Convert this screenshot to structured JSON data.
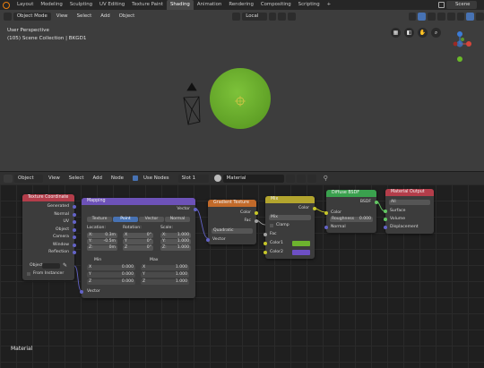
{
  "workspace_tabs": [
    "Layout",
    "Modeling",
    "Sculpting",
    "UV Editing",
    "Texture Paint",
    "Shading",
    "Animation",
    "Rendering",
    "Compositing",
    "Scripting",
    "+"
  ],
  "active_tab_index": 5,
  "scene_name": "Scene",
  "viewport": {
    "mode": "Object Mode",
    "menus": [
      "View",
      "Select",
      "Add",
      "Object"
    ],
    "transform_orientation": "Local",
    "info_line1": "User Perspective",
    "info_line2": "(105) Scene Collection | BKGD1",
    "sphere_color": "#6db32e",
    "gizmo": {
      "x": "X",
      "y": "Y",
      "z": "Z"
    }
  },
  "node_editor": {
    "object_type": "Object",
    "menus": [
      "View",
      "Select",
      "Add",
      "Node"
    ],
    "use_nodes_label": "Use Nodes",
    "slot": "Slot 1",
    "material": "Material",
    "footer_label": "Material"
  },
  "nodes": {
    "texcoord": {
      "title": "Texture Coordinate",
      "outputs": [
        "Generated",
        "Normal",
        "UV",
        "Object",
        "Camera",
        "Window",
        "Reflection"
      ],
      "object_label": "Object",
      "from_instancer": "From Instancer"
    },
    "mapping": {
      "title": "Mapping",
      "output": "Vector",
      "types": [
        "Texture",
        "Point",
        "Vector",
        "Normal"
      ],
      "active_type": "Point",
      "location_label": "Location:",
      "rotation_label": "Rotation:",
      "scale_label": "Scale:",
      "location": [
        [
          "X:",
          "0.3m"
        ],
        [
          "Y:",
          "-0.5m"
        ],
        [
          "Z:",
          "0m"
        ]
      ],
      "rotation": [
        [
          "X",
          "0°"
        ],
        [
          "Y",
          "0°"
        ],
        [
          "Z",
          "0°"
        ]
      ],
      "scale": [
        [
          "X:",
          "1.000"
        ],
        [
          "Y:",
          "1.000"
        ],
        [
          "Z:",
          "1.000"
        ]
      ],
      "min_label": "Min",
      "max_label": "Max",
      "min": [
        [
          "X",
          "0.000"
        ],
        [
          "Y",
          "0.000"
        ],
        [
          "Z",
          "0.000"
        ]
      ],
      "max": [
        [
          "X",
          "1.000"
        ],
        [
          "Y",
          "1.000"
        ],
        [
          "Z",
          "1.000"
        ]
      ],
      "input": "Vector"
    },
    "gradient": {
      "title": "Gradient Texture",
      "outputs": [
        "Color",
        "Fac"
      ],
      "type": "Quadratic",
      "input": "Vector"
    },
    "mix": {
      "title": "Mix",
      "output": "Color",
      "blend": "Mix",
      "clamp": "Clamp",
      "inputs": [
        "Fac",
        "Color1",
        "Color2"
      ],
      "color1": "#6db32e",
      "color2": "#6d4fc4"
    },
    "diffuse": {
      "title": "Diffuse BSDF",
      "output": "BSDF",
      "inputs": [
        "Color",
        "Normal"
      ],
      "roughness_label": "Roughness",
      "roughness_value": "0.000"
    },
    "output": {
      "title": "Material Output",
      "target": "All",
      "inputs": [
        "Surface",
        "Volume",
        "Displacement"
      ]
    }
  }
}
